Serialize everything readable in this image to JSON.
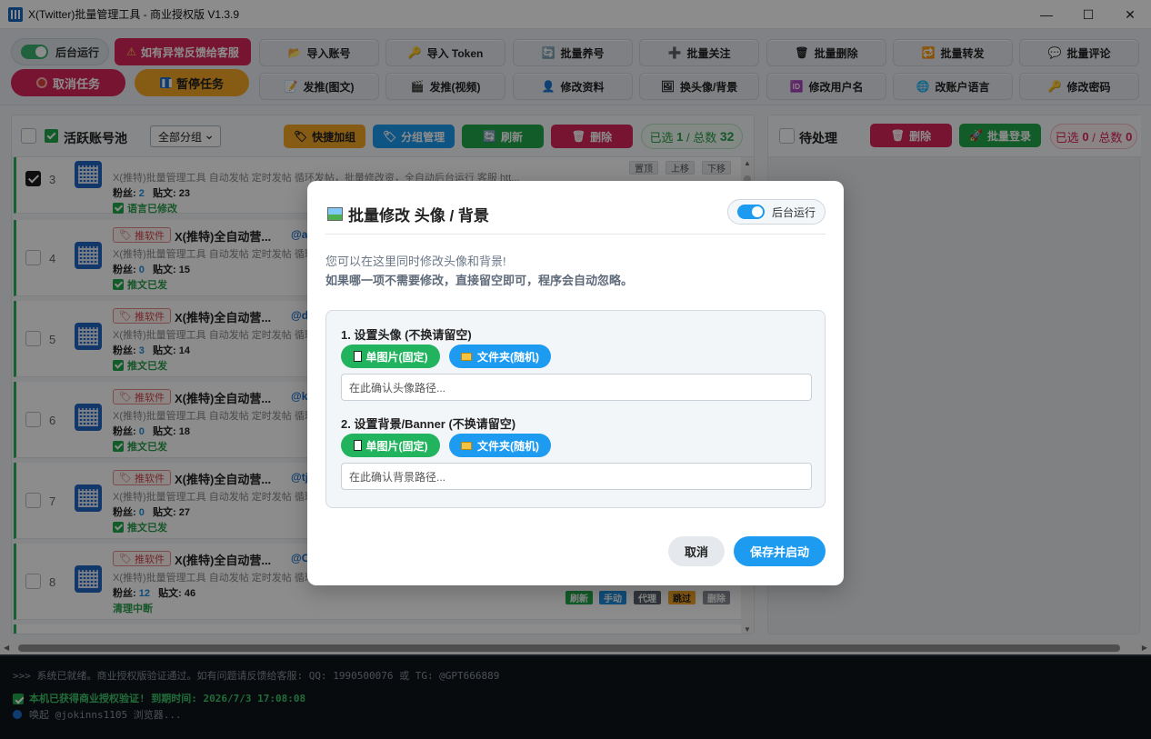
{
  "window": {
    "title": "X(Twitter)批量管理工具 - 商业授权版 V1.3.9",
    "minimize": "—",
    "maximize": "☐",
    "close": "✕"
  },
  "toolbar": {
    "bg_run_label": "后台运行",
    "feedback_label": "如有异常反馈给客服",
    "cancel_task_label": "取消任务",
    "pause_task_label": "暂停任务",
    "row1": [
      {
        "icon": "folder-icon",
        "glyph": "📂",
        "label": "导入账号"
      },
      {
        "icon": "key-icon",
        "glyph": "🔑",
        "label": "导入 Token"
      },
      {
        "icon": "refresh-icon",
        "glyph": "🔄",
        "label": "批量养号"
      },
      {
        "icon": "plus-icon",
        "glyph": "➕",
        "label": "批量关注"
      },
      {
        "icon": "trash-icon",
        "glyph": "🗑",
        "label": "批量删除"
      },
      {
        "icon": "retweet-icon",
        "glyph": "🔁",
        "label": "批量转发"
      },
      {
        "icon": "comment-icon",
        "glyph": "💬",
        "label": "批量评论"
      }
    ],
    "row2": [
      {
        "icon": "edit-icon",
        "glyph": "📝",
        "label": "发推(图文)"
      },
      {
        "icon": "video-icon",
        "glyph": "🎬",
        "label": "发推(视频)"
      },
      {
        "icon": "user-icon",
        "glyph": "👤",
        "label": "修改资料"
      },
      {
        "icon": "image-icon",
        "glyph": "🖼",
        "label": "换头像/背景"
      },
      {
        "icon": "id-icon",
        "glyph": "🆔",
        "label": "修改用户名"
      },
      {
        "icon": "globe-icon",
        "glyph": "🌐",
        "label": "改账户语言"
      },
      {
        "icon": "key-icon",
        "glyph": "🔑",
        "label": "修改密码"
      }
    ]
  },
  "left_panel": {
    "title": "活跃账号池",
    "group_select": "全部分组",
    "quick_group": "快捷加组",
    "group_manage": "分组管理",
    "refresh": "刷新",
    "delete": "删除",
    "selected_prefix": "已选",
    "selected_count": "1",
    "total_sep": "/ 总数",
    "total_count": "32",
    "rows": [
      {
        "num": "3",
        "tag": "",
        "name": "",
        "handle": "",
        "desc": "X(推特)批量管理工具 自动发帖 定时发帖 循环发帖，批量修改资，全自动后台运行 客服 htt...",
        "fans_label": "粉丝:",
        "fans": "2",
        "posts_label": "贴文:",
        "posts": "23",
        "status": "语言已修改",
        "checked": true
      },
      {
        "num": "4",
        "tag": "推软件",
        "name": "X(推特)全自动营...",
        "handle": "@a",
        "desc": "X(推特)批量管理工具 自动发帖 定时发帖 循环",
        "fans_label": "粉丝:",
        "fans": "0",
        "posts_label": "贴文:",
        "posts": "15",
        "status": "推文已发",
        "checked": false
      },
      {
        "num": "5",
        "tag": "推软件",
        "name": "X(推特)全自动营...",
        "handle": "@d",
        "desc": "X(推特)批量管理工具 自动发帖 定时发帖 循环",
        "fans_label": "粉丝:",
        "fans": "3",
        "posts_label": "贴文:",
        "posts": "14",
        "status": "推文已发",
        "checked": false
      },
      {
        "num": "6",
        "tag": "推软件",
        "name": "X(推特)全自动营...",
        "handle": "@k",
        "desc": "X(推特)批量管理工具 自动发帖 定时发帖 循环",
        "fans_label": "粉丝:",
        "fans": "0",
        "posts_label": "贴文:",
        "posts": "18",
        "status": "推文已发",
        "checked": false
      },
      {
        "num": "7",
        "tag": "推软件",
        "name": "X(推特)全自动营...",
        "handle": "@tj",
        "desc": "X(推特)批量管理工具 自动发帖 定时发帖 循环",
        "fans_label": "粉丝:",
        "fans": "0",
        "posts_label": "贴文:",
        "posts": "27",
        "status": "推文已发",
        "checked": false
      },
      {
        "num": "8",
        "tag": "推软件",
        "name": "X(推特)全自动营...",
        "handle": "@C",
        "desc": "X(推特)批量管理工具 自动发帖 定时发帖 循环",
        "fans_label": "粉丝:",
        "fans": "12",
        "posts_label": "贴文:",
        "posts": "46",
        "status": "清理中断",
        "checked": false
      }
    ],
    "row_buttons_top": [
      "置顶",
      "上移",
      "下移"
    ],
    "row_buttons_bottom": [
      "刷新",
      "手动",
      "代理",
      "跳过",
      "删除"
    ]
  },
  "right_panel": {
    "title": "待处理",
    "delete": "删除",
    "batch_login": "批量登录",
    "selected_prefix": "已选",
    "selected_count": "0",
    "total_sep": "/ 总数",
    "total_count": "0"
  },
  "console": {
    "line1": ">>> 系统已就绪。商业授权版验证通过。如有问题请反馈给客服: QQ: 1990500076 或 TG: @GPT666889",
    "line2": "本机已获得商业授权验证! 到期时间: 2026/7/3 17:08:08",
    "line3": "唤起 @jokinns1105 浏览器..."
  },
  "modal": {
    "title": "批量修改 头像 / 背景",
    "bg_toggle_label": "后台运行",
    "desc1": "您可以在这里同时修改头像和背景!",
    "desc2": "如果哪一项不需要修改，直接留空即可，程序会自动忽略。",
    "avatar_section": "1. 设置头像 (不换请留空)",
    "banner_section": "2. 设置背景/Banner (不换请留空)",
    "single_image_btn": "单图片(固定)",
    "folder_btn": "文件夹(随机)",
    "avatar_placeholder": "在此确认头像路径...",
    "banner_placeholder": "在此确认背景路径...",
    "cancel": "取消",
    "save": "保存并启动"
  },
  "colors": {
    "accent": "#1d9bf0",
    "green": "#22b35e",
    "red": "#d8265c",
    "orange": "#f5a623"
  }
}
